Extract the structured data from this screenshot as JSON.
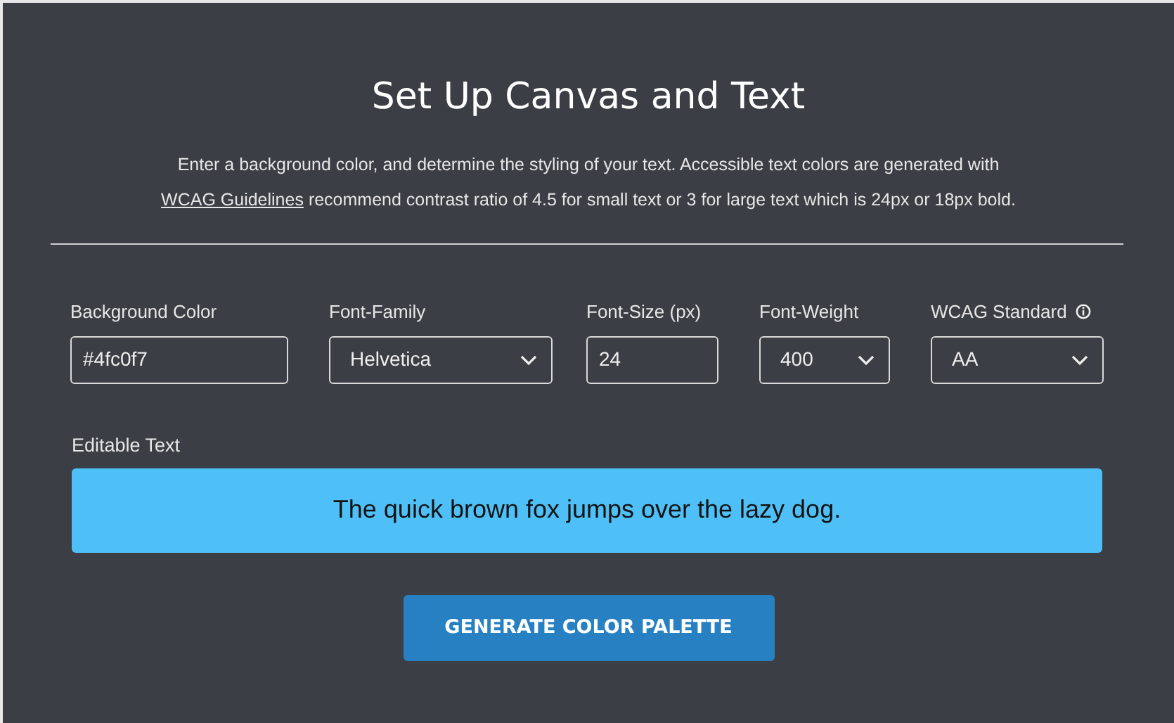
{
  "title": "Set Up Canvas and Text",
  "intro": {
    "before": "Enter a background color, and determine the styling of your text. Accessible text colors are generated with",
    "link": "WCAG Guidelines",
    "after": " recommend contrast ratio of 4.5 for small text or 3 for large text which is 24px or 18px bold."
  },
  "fields": [
    {
      "kind": "text",
      "label": "Background Color",
      "value": "#4fc0f7",
      "info": false
    },
    {
      "kind": "select",
      "label": "Font-Family",
      "value": "Helvetica",
      "info": false
    },
    {
      "kind": "text",
      "label": "Font-Size (px)",
      "value": "24",
      "info": false
    },
    {
      "kind": "select",
      "label": "Font-Weight",
      "value": "400",
      "info": false
    },
    {
      "kind": "select",
      "label": "WCAG Standard",
      "value": "AA",
      "info": true
    }
  ],
  "editable": {
    "label": "Editable Text",
    "text": "The quick brown fox jumps over the lazy dog."
  },
  "button": "GENERATE COLOR PALETTE"
}
